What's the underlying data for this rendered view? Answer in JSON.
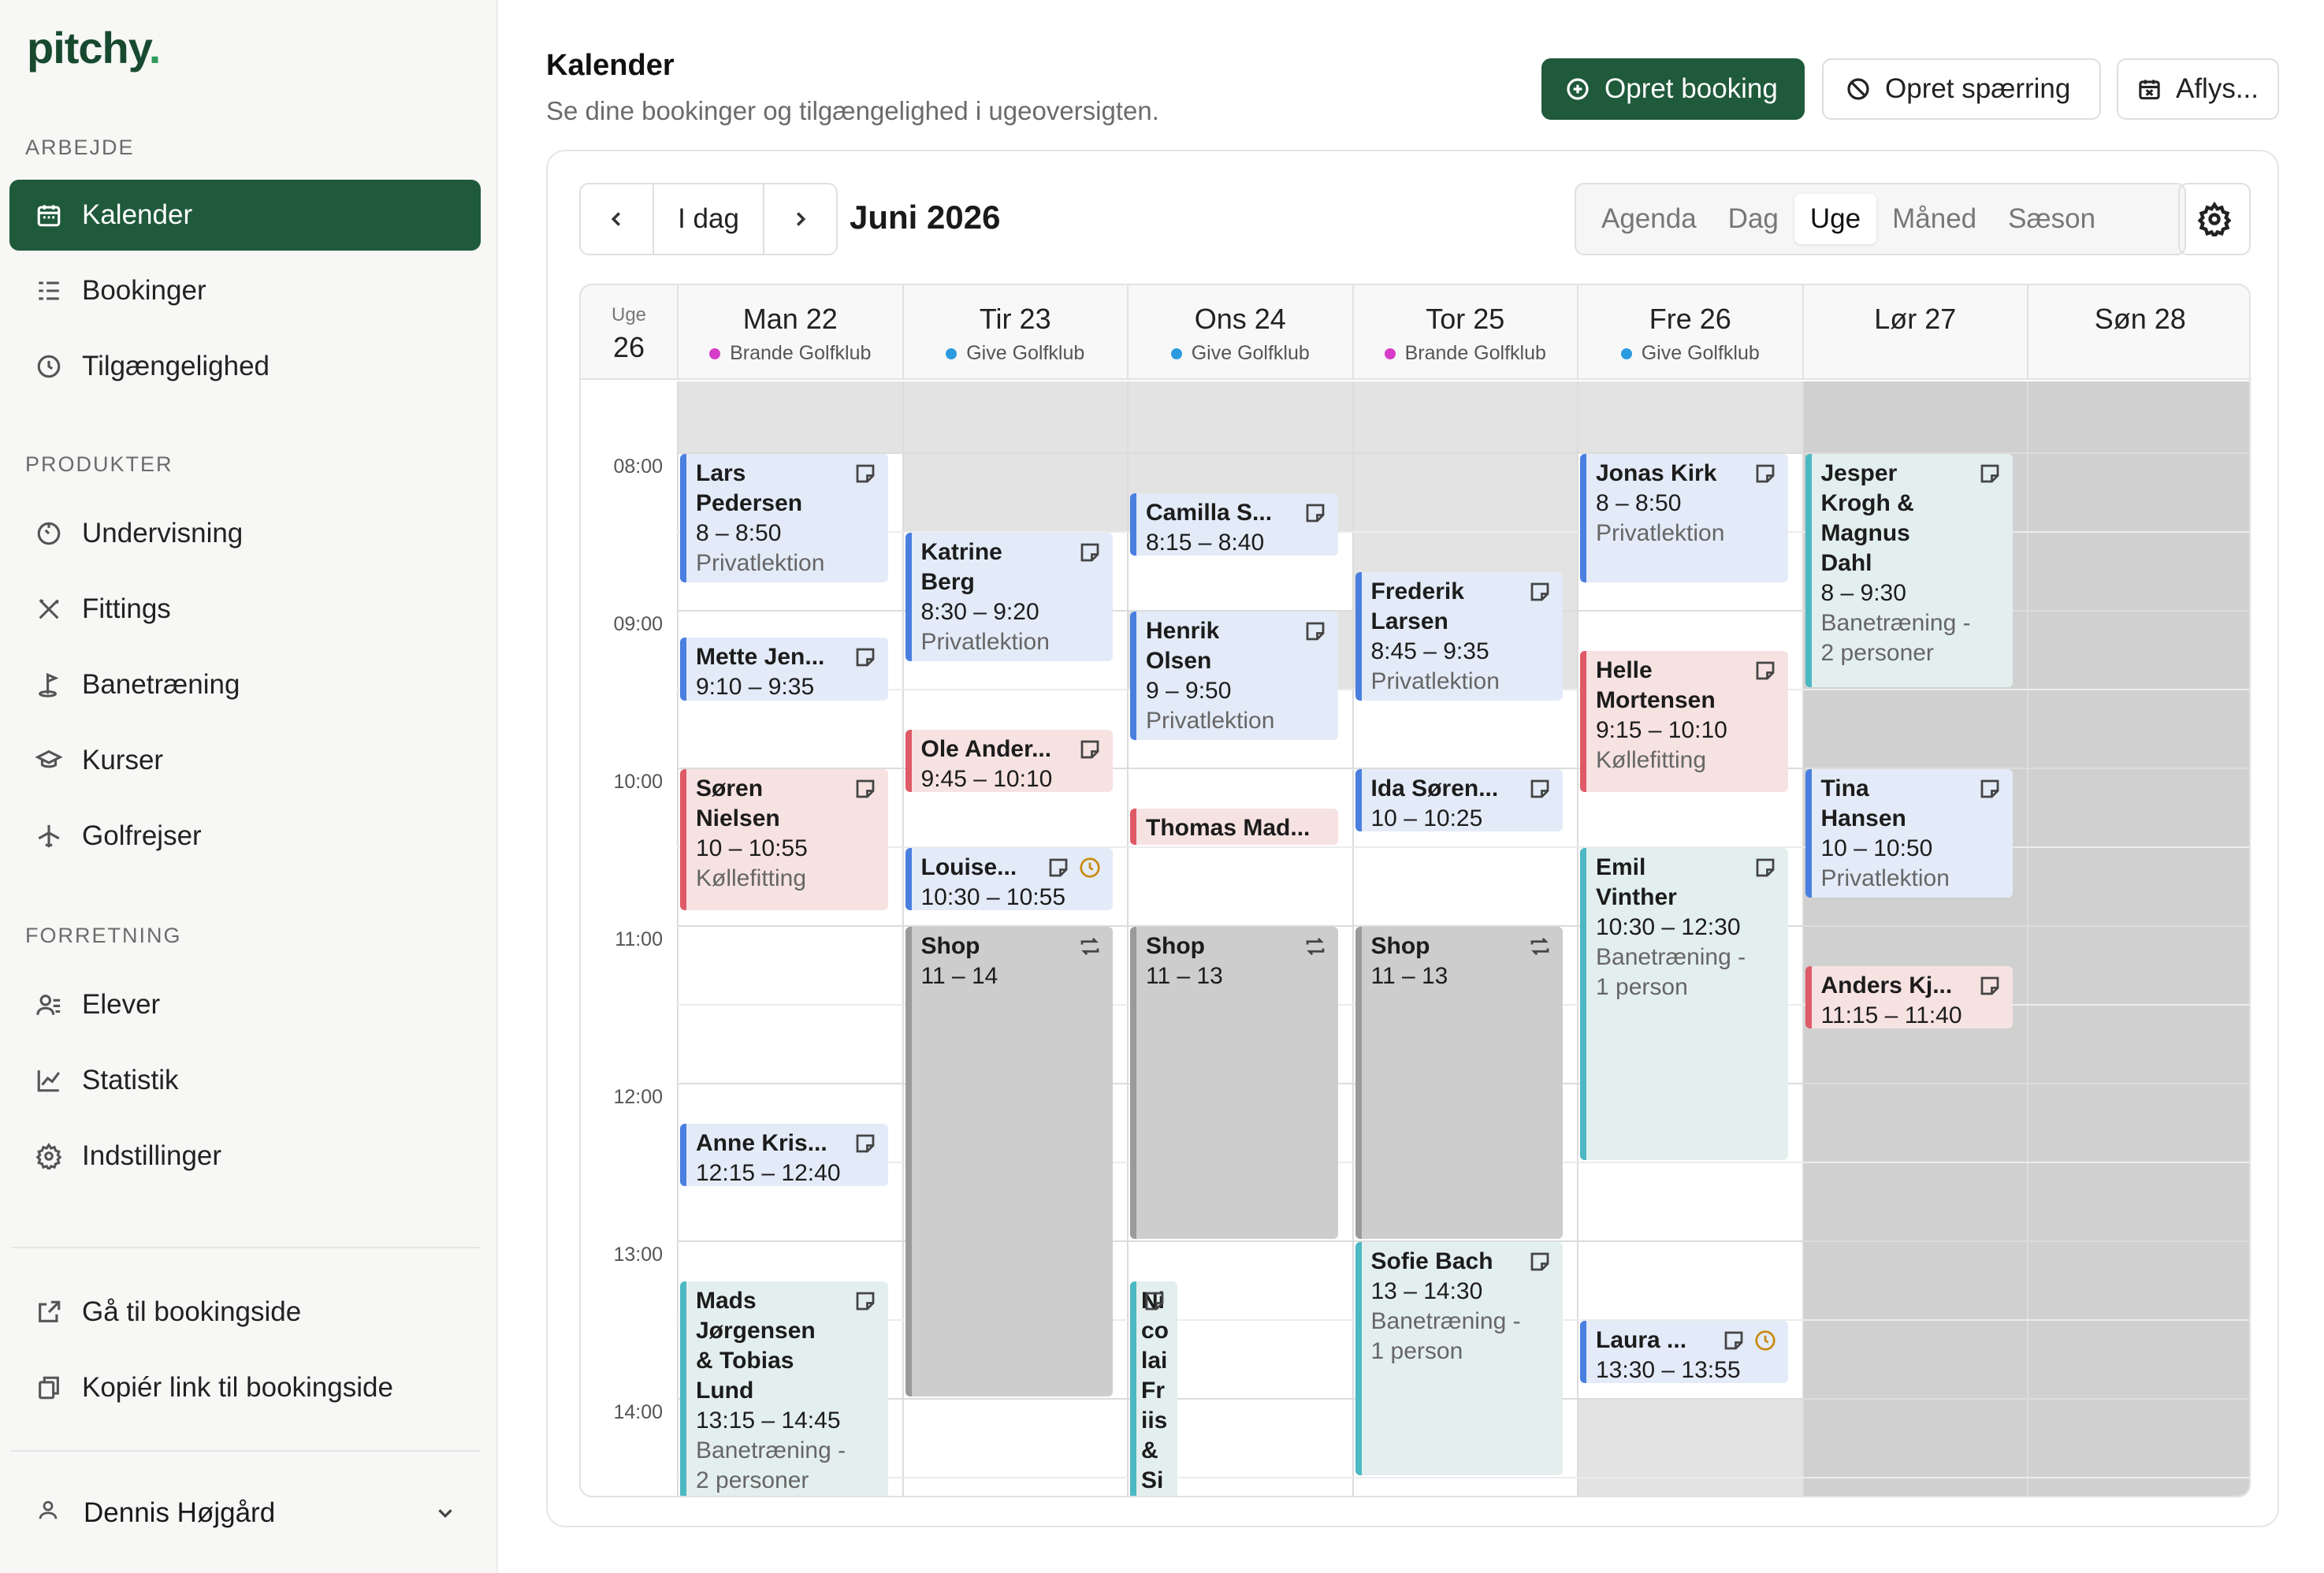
{
  "brand": {
    "name": "pitchy",
    "dot": "."
  },
  "sidebar": {
    "sections": [
      {
        "label": "ARBEJDE"
      },
      {
        "label": "PRODUKTER"
      },
      {
        "label": "FORRETNING"
      }
    ],
    "items": [
      {
        "label": "Kalender",
        "icon": "calendar-icon",
        "active": true
      },
      {
        "label": "Bookinger",
        "icon": "list-icon"
      },
      {
        "label": "Tilgængelighed",
        "icon": "clock-icon"
      },
      {
        "label": "Undervisning",
        "icon": "timer-icon"
      },
      {
        "label": "Fittings",
        "icon": "tools-icon"
      },
      {
        "label": "Banetræning",
        "icon": "golf-flag-icon"
      },
      {
        "label": "Kurser",
        "icon": "graduation-cap-icon"
      },
      {
        "label": "Golfrejser",
        "icon": "plane-icon"
      },
      {
        "label": "Elever",
        "icon": "users-icon"
      },
      {
        "label": "Statistik",
        "icon": "chart-icon"
      },
      {
        "label": "Indstillinger",
        "icon": "gear-icon"
      }
    ],
    "links": [
      {
        "label": "Gå til bookingside",
        "icon": "external-link-icon"
      },
      {
        "label": "Kopiér link til bookingside",
        "icon": "copy-icon"
      }
    ],
    "user": {
      "name": "Dennis Højgård"
    }
  },
  "header": {
    "title": "Kalender",
    "subtitle": "Se dine bookinger og tilgængelighed i ugeoversigten.",
    "buttons": {
      "create_booking": "Opret booking",
      "create_block": "Opret spærring",
      "cancel": "Aflys..."
    }
  },
  "calendar": {
    "today_label": "I dag",
    "month_label": "Juni 2026",
    "views": [
      "Agenda",
      "Dag",
      "Uge",
      "Måned",
      "Sæson"
    ],
    "active_view": "Uge",
    "week_label": "Uge",
    "week_number": "26",
    "days": [
      {
        "label": "Man 22",
        "club": "Brande Golfklub",
        "club_color": "#d63cc9"
      },
      {
        "label": "Tir 23",
        "club": "Give Golfklub",
        "club_color": "#2b9be0"
      },
      {
        "label": "Ons 24",
        "club": "Give Golfklub",
        "club_color": "#2b9be0"
      },
      {
        "label": "Tor 25",
        "club": "Brande Golfklub",
        "club_color": "#d63cc9"
      },
      {
        "label": "Fre 26",
        "club": "Give Golfklub",
        "club_color": "#2b9be0"
      },
      {
        "label": "Lør 27",
        "club": "",
        "club_color": ""
      },
      {
        "label": "Søn 28",
        "club": "",
        "club_color": ""
      }
    ],
    "time_labels": [
      "08:00",
      "09:00",
      "10:00",
      "11:00",
      "12:00",
      "13:00",
      "14:00"
    ],
    "events": [
      {
        "day": 0,
        "start": 8.0,
        "end": 8.8333,
        "color": "blue",
        "lines": [
          "Lars",
          "Pedersen"
        ],
        "time": "8 – 8:50",
        "type": "Privatlektion"
      },
      {
        "day": 0,
        "start": 9.1667,
        "end": 9.5833,
        "color": "blue",
        "lines": [
          "Mette Jen..."
        ],
        "time": "9:10 – 9:35",
        "type": ""
      },
      {
        "day": 0,
        "start": 10.0,
        "end": 10.9167,
        "color": "red",
        "lines": [
          "Søren",
          "Nielsen"
        ],
        "time": "10 – 10:55",
        "type": "Køllefitting"
      },
      {
        "day": 0,
        "start": 12.25,
        "end": 12.6667,
        "color": "blue",
        "lines": [
          "Anne Kris..."
        ],
        "time": "12:15 – 12:40",
        "type": ""
      },
      {
        "day": 0,
        "start": 13.25,
        "end": 14.75,
        "color": "teal",
        "lines": [
          "Mads",
          "Jørgensen",
          "& Tobias",
          "Lund"
        ],
        "time": "13:15 – 14:45",
        "type": "Banetræning -",
        "type2": "2 personer"
      },
      {
        "day": 1,
        "start": 8.5,
        "end": 9.3333,
        "color": "blue",
        "lines": [
          "Katrine",
          "Berg"
        ],
        "time": "8:30 – 9:20",
        "type": "Privatlektion"
      },
      {
        "day": 1,
        "start": 9.75,
        "end": 10.1667,
        "color": "red",
        "lines": [
          "Ole Ander..."
        ],
        "time": "9:45 – 10:10",
        "type": ""
      },
      {
        "day": 1,
        "start": 10.5,
        "end": 10.9167,
        "color": "blue",
        "lines": [
          "Louise..."
        ],
        "time": "10:30 – 10:55",
        "type": "",
        "clock": true
      },
      {
        "day": 1,
        "start": 11.0,
        "end": 14.0,
        "color": "shop",
        "lines": [
          "Shop"
        ],
        "time": "11 – 14",
        "type": "",
        "repeat": true
      },
      {
        "day": 2,
        "start": 8.25,
        "end": 8.6667,
        "color": "blue",
        "lines": [
          "Camilla S..."
        ],
        "time": "8:15 – 8:40",
        "type": ""
      },
      {
        "day": 2,
        "start": 9.0,
        "end": 9.8333,
        "color": "blue",
        "lines": [
          "Henrik",
          "Olsen"
        ],
        "time": "9 – 9:50",
        "type": "Privatlektion"
      },
      {
        "day": 2,
        "start": 10.25,
        "end": 10.5,
        "color": "red",
        "lines": [
          "Thomas Mad..."
        ],
        "time": "",
        "type": "",
        "noicon": true
      },
      {
        "day": 2,
        "start": 11.0,
        "end": 13.0,
        "color": "shop",
        "lines": [
          "Shop"
        ],
        "time": "11 – 13",
        "type": "",
        "repeat": true
      },
      {
        "day": 2,
        "start": 13.25,
        "end": 14.75,
        "color": "teal",
        "lines": [
          "Ni",
          "co",
          "lai",
          "Fr",
          "iis",
          "&",
          "Si"
        ],
        "time": "",
        "type": "",
        "narrow": true
      },
      {
        "day": 3,
        "start": 8.75,
        "end": 9.5833,
        "color": "blue",
        "lines": [
          "Frederik",
          "Larsen"
        ],
        "time": "8:45 – 9:35",
        "type": "Privatlektion"
      },
      {
        "day": 3,
        "start": 10.0,
        "end": 10.4167,
        "color": "blue",
        "lines": [
          "Ida Søren..."
        ],
        "time": "10 – 10:25",
        "type": ""
      },
      {
        "day": 3,
        "start": 11.0,
        "end": 13.0,
        "color": "shop",
        "lines": [
          "Shop"
        ],
        "time": "11 – 13",
        "type": "",
        "repeat": true
      },
      {
        "day": 3,
        "start": 13.0,
        "end": 14.5,
        "color": "teal",
        "lines": [
          "Sofie Bach"
        ],
        "time": "13 – 14:30",
        "type": "Banetræning -",
        "type2": "1 person"
      },
      {
        "day": 4,
        "start": 8.0,
        "end": 8.8333,
        "color": "blue",
        "lines": [
          "Jonas Kirk"
        ],
        "time": "8 – 8:50",
        "type": "Privatlektion"
      },
      {
        "day": 4,
        "start": 9.25,
        "end": 10.1667,
        "color": "red",
        "lines": [
          "Helle",
          "Mortensen"
        ],
        "time": "9:15 – 10:10",
        "type": "Køllefitting"
      },
      {
        "day": 4,
        "start": 10.5,
        "end": 12.5,
        "color": "teal",
        "lines": [
          "Emil",
          "Vinther"
        ],
        "time": "10:30 – 12:30",
        "type": "Banetræning -",
        "type2": "1 person"
      },
      {
        "day": 4,
        "start": 13.5,
        "end": 13.9167,
        "color": "blue",
        "lines": [
          "Laura ..."
        ],
        "time": "13:30 – 13:55",
        "type": "",
        "clock": true
      },
      {
        "day": 5,
        "start": 8.0,
        "end": 9.5,
        "color": "teal",
        "lines": [
          "Jesper",
          "Krogh &",
          "Magnus",
          "Dahl"
        ],
        "time": "8 – 9:30",
        "type": "Banetræning -",
        "type2": "2 personer"
      },
      {
        "day": 5,
        "start": 10.0,
        "end": 10.8333,
        "color": "blue",
        "lines": [
          "Tina",
          "Hansen"
        ],
        "time": "10 – 10:50",
        "type": "Privatlektion"
      },
      {
        "day": 5,
        "start": 11.25,
        "end": 11.6667,
        "color": "red",
        "lines": [
          "Anders Kj..."
        ],
        "time": "11:15 – 11:40",
        "type": ""
      }
    ]
  }
}
